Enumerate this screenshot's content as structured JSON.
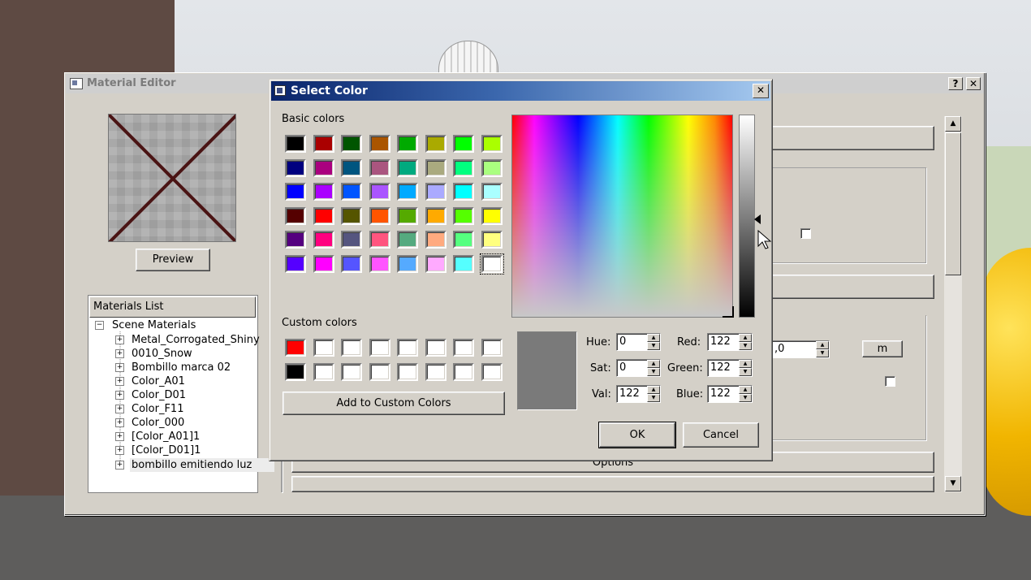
{
  "material_editor": {
    "title": "Material Editor",
    "help_label": "?",
    "close_label": "✕",
    "preview_button": "Preview",
    "materials_list_header": "Materials List",
    "tree": {
      "root": "Scene Materials",
      "items": [
        "Metal_Corrogated_Shiny",
        "0010_Snow",
        "Bombillo marca 02",
        "Color_A01",
        "Color_D01",
        "Color_F11",
        "Color_000",
        "[Color_A01]1",
        "[Color_D01]1",
        "bombillo emitiendo luz"
      ]
    },
    "partial_field_value": ",0",
    "unit_button": "m",
    "options_button": "Options"
  },
  "select_color": {
    "title": "Select Color",
    "close_label": "✕",
    "basic_colors_label": "Basic colors",
    "basic_colors": [
      [
        "#000000",
        "#aa0000",
        "#005500",
        "#aa5500",
        "#00aa00",
        "#aaaa00",
        "#00ff00",
        "#aaff00"
      ],
      [
        "#00007f",
        "#aa007f",
        "#00557f",
        "#aa557f",
        "#00aa7f",
        "#aaaa7f",
        "#00ff7f",
        "#aaff7f"
      ],
      [
        "#0000ff",
        "#aa00ff",
        "#0055ff",
        "#aa55ff",
        "#00aaff",
        "#aaaaff",
        "#00ffff",
        "#aaffff"
      ],
      [
        "#550000",
        "#ff0000",
        "#555500",
        "#ff5500",
        "#55aa00",
        "#ffaa00",
        "#55ff00",
        "#ffff00"
      ],
      [
        "#55007f",
        "#ff007f",
        "#55557f",
        "#ff557f",
        "#55aa7f",
        "#ffaa7f",
        "#55ff7f",
        "#ffff7f"
      ],
      [
        "#5500ff",
        "#ff00ff",
        "#5555ff",
        "#ff55ff",
        "#55aaff",
        "#ffaaff",
        "#55ffff",
        "#ffffff"
      ]
    ],
    "custom_colors_label": "Custom colors",
    "custom_colors": [
      [
        "#ff0000",
        "#ffffff",
        "#ffffff",
        "#ffffff",
        "#ffffff",
        "#ffffff",
        "#ffffff",
        "#ffffff"
      ],
      [
        "#000000",
        "#ffffff",
        "#ffffff",
        "#ffffff",
        "#ffffff",
        "#ffffff",
        "#ffffff",
        "#ffffff"
      ]
    ],
    "add_custom_button": "Add to Custom Colors",
    "current_color": "#7a7a7a",
    "fields": {
      "hue_label": "Hue:",
      "hue": "0",
      "sat_label": "Sat:",
      "sat": "0",
      "val_label": "Val:",
      "val": "122",
      "red_label": "Red:",
      "red": "122",
      "green_label": "Green:",
      "green": "122",
      "blue_label": "Blue:",
      "blue": "122"
    },
    "ok_button": "OK",
    "cancel_button": "Cancel"
  }
}
